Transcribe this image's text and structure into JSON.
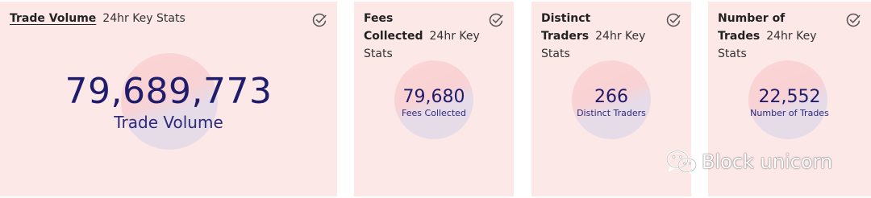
{
  "cards": [
    {
      "title": "Trade Volume",
      "subtitle": "24hr Key Stats",
      "value": "79,689,773",
      "label": "Trade Volume",
      "icon": "check-circle-icon"
    },
    {
      "title": "Fees Collected",
      "subtitle": "24hr Key Stats",
      "value": "79,680",
      "label": "Fees Collected",
      "icon": "check-circle-icon"
    },
    {
      "title": "Distinct Traders",
      "subtitle": "24hr Key Stats",
      "value": "266",
      "label": "Distinct Traders",
      "icon": "check-circle-icon"
    },
    {
      "title": "Number of Trades",
      "subtitle": "24hr Key Stats",
      "value": "22,552",
      "label": "Number of Trades",
      "icon": "check-circle-icon"
    }
  ],
  "watermark": {
    "text": "Block unicorn",
    "icon": "wechat-icon"
  },
  "colors": {
    "card_bg": "#fde8e8",
    "value_text": "#1f1c6b",
    "circle_top": "#fcd6d6",
    "circle_bottom": "#e6dde8"
  }
}
